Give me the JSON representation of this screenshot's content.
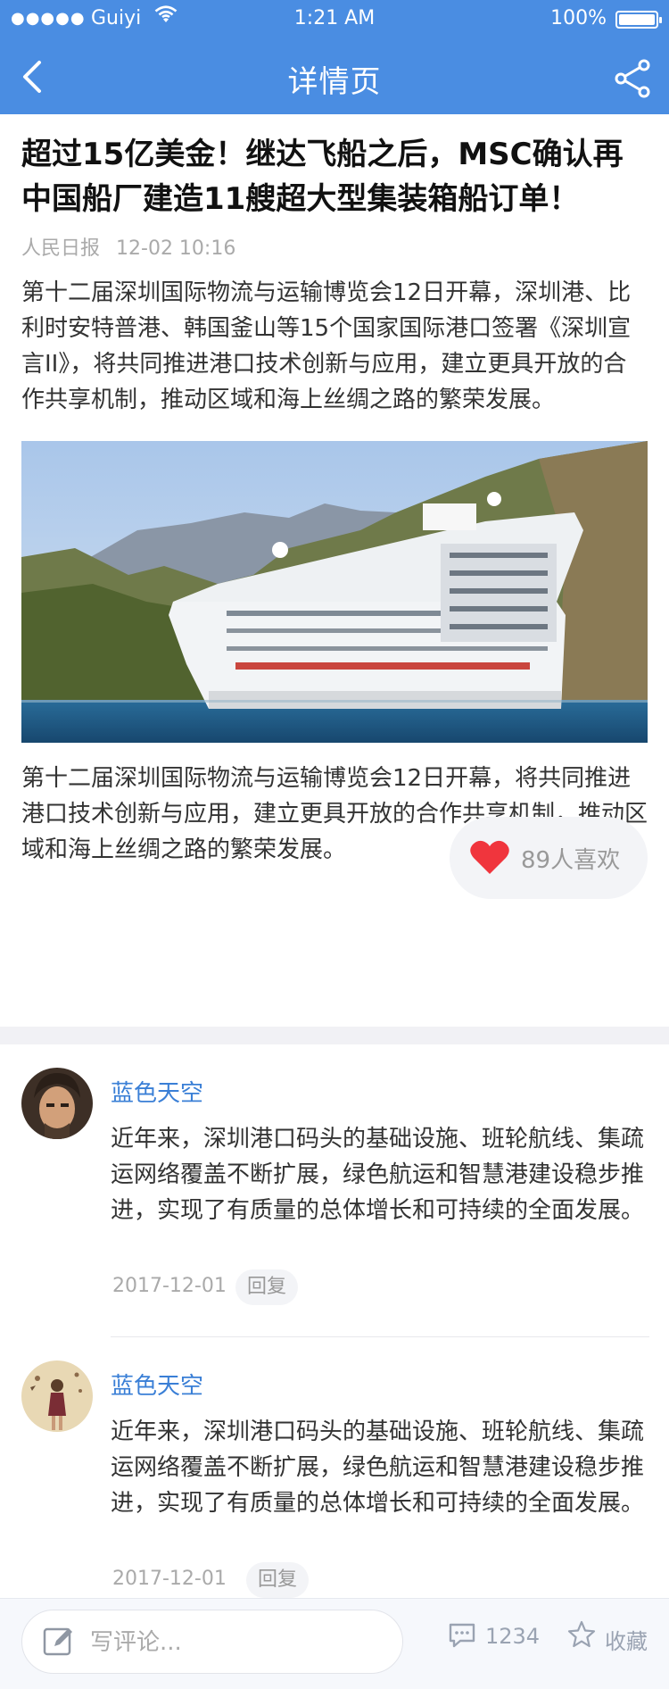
{
  "status": {
    "carrier": "Guiyi",
    "time": "1:21 AM",
    "battery": "100%"
  },
  "navbar": {
    "title": "详情页"
  },
  "article": {
    "title": "超过15亿美金！继达飞船之后，MSC确认再中国船厂建造11艘超大型集装箱船订单！",
    "source": "人民日报",
    "datetime": "12-02 10:16",
    "paragraph1": "第十二届深圳国际物流与运输博览会12日开幕，深圳港、比利时安特普港、韩国釜山等15个国家国际港口签署《深圳宣言II》，将共同推进港口技术创新与应用，建立更具开放的合作共享机制，推动区域和海上丝绸之路的繁荣发展。",
    "paragraph2": "第十二届深圳国际物流与运输博览会12日开幕，将共同推进港口技术创新与应用，建立更具开放的合作共享机制，推动区域和海上丝绸之路的繁荣发展。",
    "likes_label": "89人喜欢"
  },
  "comments": [
    {
      "user": "蓝色天空",
      "text": "近年来，深圳港口码头的基础设施、班轮航线、集疏运网络覆盖不断扩展，绿色航运和智慧港建设稳步推进，实现了有质量的总体增长和可持续的全面发展。",
      "date": "2017-12-01",
      "reply_label": "回复"
    },
    {
      "user": "蓝色天空",
      "text": "近年来，深圳港口码头的基础设施、班轮航线、集疏运网络覆盖不断扩展，绿色航运和智慧港建设稳步推进，实现了有质量的总体增长和可持续的全面发展。",
      "date": "2017-12-01",
      "reply_label": "回复"
    }
  ],
  "bottombar": {
    "input_placeholder": "写评论...",
    "comment_count": "1234",
    "favorite_label": "收藏"
  },
  "colors": {
    "header": "#4a8de2",
    "username": "#3a7fd6",
    "heart": "#f0353d"
  },
  "icons": [
    "back-arrow-icon",
    "share-icon",
    "heart-icon",
    "pen-icon",
    "comment-bubble-icon",
    "star-icon",
    "wifi-icon",
    "battery-icon"
  ]
}
